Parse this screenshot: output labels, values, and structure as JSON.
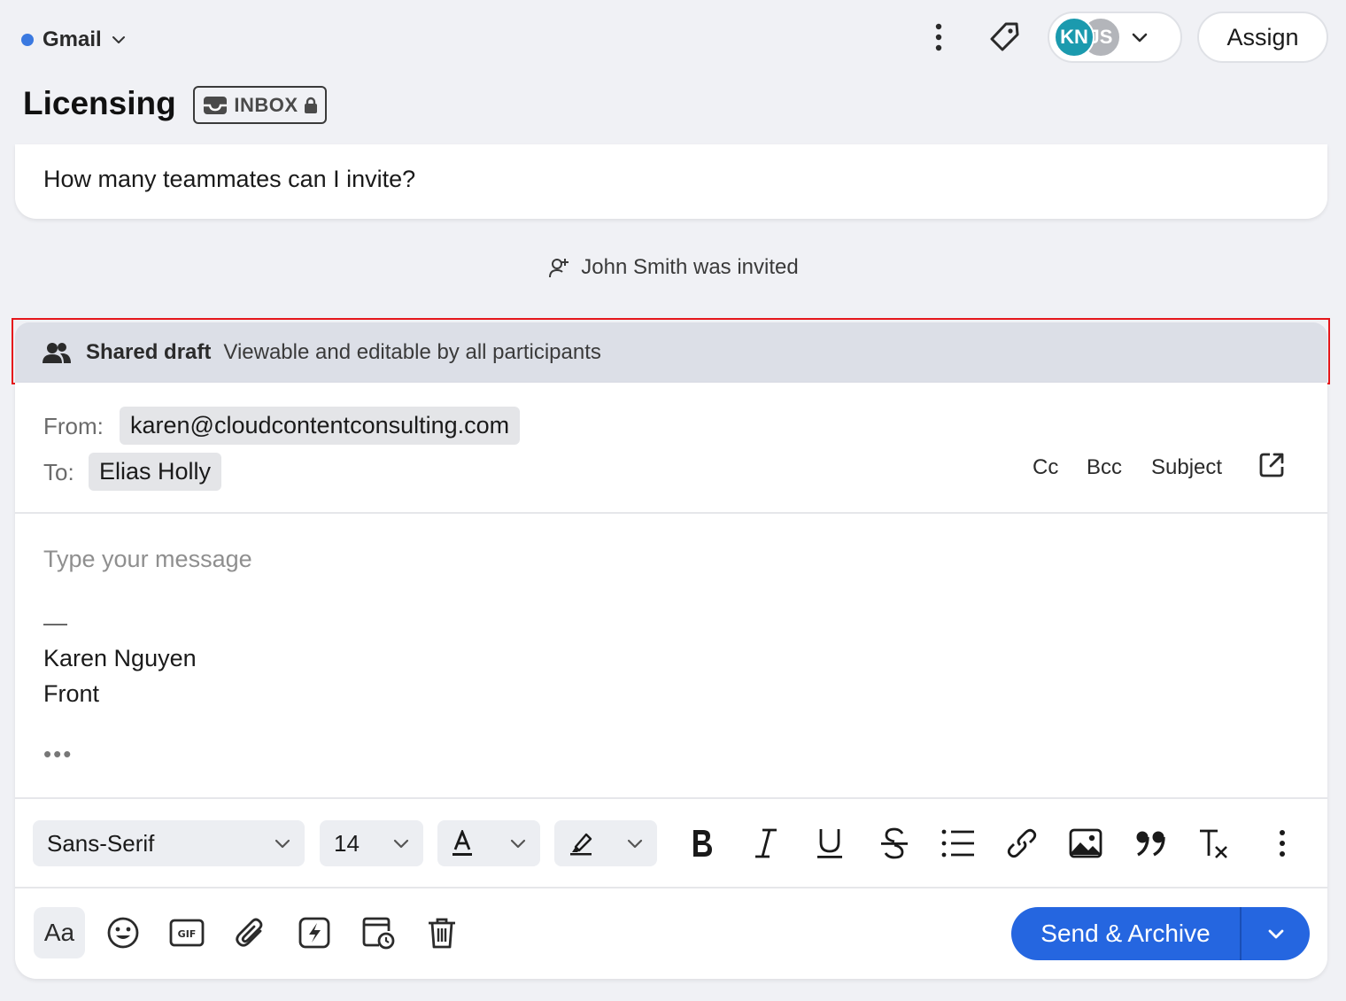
{
  "header": {
    "channel_name": "Gmail",
    "channel_dot_color": "#3a79e0",
    "conversation_title": "Licensing",
    "inbox_badge": "INBOX",
    "assignees": [
      {
        "initials": "KN",
        "color": "#1b9aae"
      },
      {
        "initials": "JS",
        "color": "#b3b5ba"
      }
    ],
    "assign_label": "Assign"
  },
  "message": {
    "body": "How many teammates can I invite?"
  },
  "event": {
    "text": "John Smith was invited"
  },
  "shared_draft": {
    "label": "Shared draft",
    "description": "Viewable and editable by all participants"
  },
  "composer": {
    "from_label": "From:",
    "from_value": "karen@cloudcontentconsulting.com",
    "to_label": "To:",
    "to_value": "Elias Holly",
    "cc_label": "Cc",
    "bcc_label": "Bcc",
    "subject_label": "Subject",
    "body_placeholder": "Type your message",
    "signature_dash": "—",
    "signature_name": "Karen Nguyen",
    "signature_company": "Front",
    "trimmed_content": "•••"
  },
  "toolbar": {
    "font_family": "Sans-Serif",
    "font_size": "14",
    "icons": [
      "bold-icon",
      "italic-icon",
      "underline-icon",
      "strikethrough-icon",
      "bullet-list-icon",
      "link-icon",
      "image-icon",
      "quote-icon",
      "clear-format-icon",
      "more-icon"
    ]
  },
  "bottom_bar": {
    "format_toggle": "Aa",
    "send_label": "Send & Archive",
    "accent_color": "#2566e0"
  }
}
